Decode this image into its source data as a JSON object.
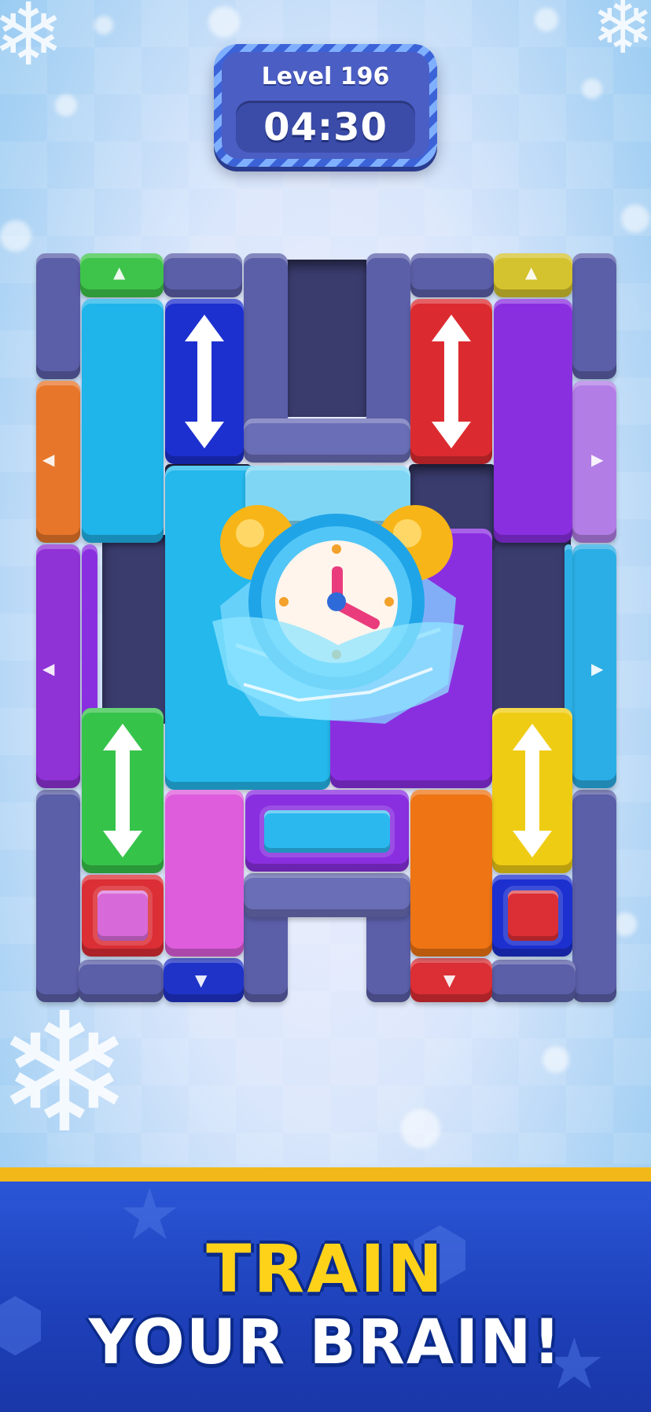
{
  "level": {
    "label": "Level 196",
    "timer": "04:30"
  },
  "banner": {
    "line1": "TRAIN",
    "line2": "YOUR BRAIN!"
  },
  "colors": {
    "banner_blue": "#1d3fb8",
    "banner_gold": "#f2b81a",
    "headline_yellow": "#ffd21a",
    "wall": "#5b5fa8"
  },
  "icons": [
    "alarm-clock-icon",
    "snowflake-icon",
    "up-down-arrow-icon",
    "triangle-arrow-icon"
  ]
}
